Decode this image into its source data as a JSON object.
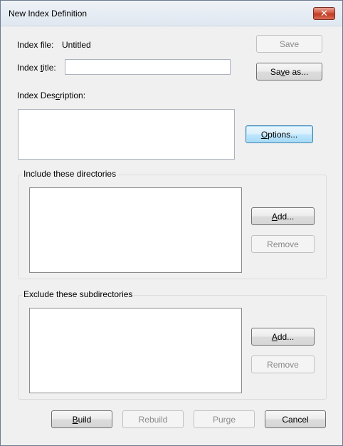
{
  "window": {
    "title": "New Index Definition",
    "close_glyph": "✕"
  },
  "index_file": {
    "label": "Index file:",
    "value": "Untitled"
  },
  "index_title": {
    "label_pre": "Index ",
    "label_key": "t",
    "label_post": "itle:",
    "value": ""
  },
  "index_description": {
    "label_pre": "Index Des",
    "label_key": "c",
    "label_post": "ription:",
    "value": ""
  },
  "buttons": {
    "save": "Save",
    "save_as_pre": "Sa",
    "save_as_key": "v",
    "save_as_post": "e as...",
    "options_key": "O",
    "options_post": "ptions...",
    "include_add_key": "A",
    "include_add_post": "dd...",
    "include_remove": "Remove",
    "exclude_add_key": "A",
    "exclude_add_post": "dd...",
    "exclude_remove": "Remove",
    "build_key": "B",
    "build_post": "uild",
    "rebuild": "Rebuild",
    "purge": "Purge",
    "cancel": "Cancel"
  },
  "include_group": {
    "label": "Include these directories",
    "items": []
  },
  "exclude_group": {
    "label": "Exclude these subdirectories",
    "items": []
  },
  "colors": {
    "close_red": "#c23b24",
    "focus_blue": "#3c7fb1"
  }
}
